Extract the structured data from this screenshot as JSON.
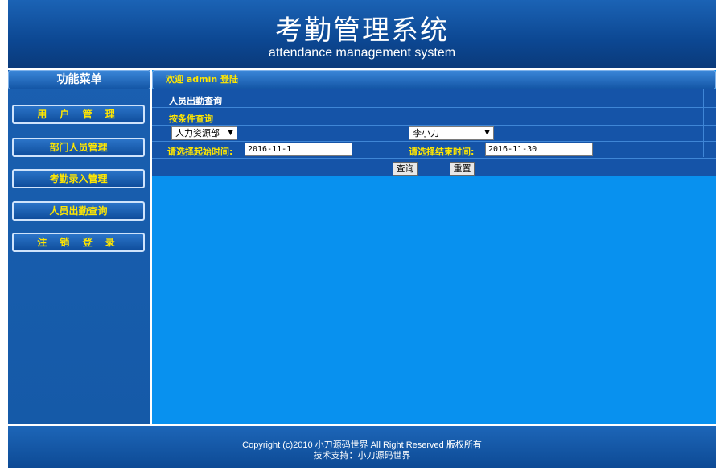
{
  "header": {
    "title": "考勤管理系统",
    "subtitle": "attendance management system"
  },
  "sidebar": {
    "title": "功能菜单",
    "items": [
      {
        "label": "用 户 管 理"
      },
      {
        "label": "部门人员管理"
      },
      {
        "label": "考勤录入管理"
      },
      {
        "label": "人员出勤查询"
      },
      {
        "label": "注 销 登 录"
      }
    ]
  },
  "main": {
    "welcome": "欢迎 admin 登陆",
    "section_title": "人员出勤查询",
    "condition_label": "按条件查询",
    "department_select": {
      "value": "人力资源部"
    },
    "person_select": {
      "value": "李小刀"
    },
    "start_label": "请选择起始时间:",
    "start_value": "2016-11-1",
    "end_label": "请选择结束时间:",
    "end_value": "2016-11-30",
    "query_button": "查询",
    "reset_button": "重置"
  },
  "footer": {
    "copyright": "Copyright (c)2010  小刀源码世界  All Right Reserved  版权所有",
    "support": "技术支持：小刀源码世界"
  }
}
